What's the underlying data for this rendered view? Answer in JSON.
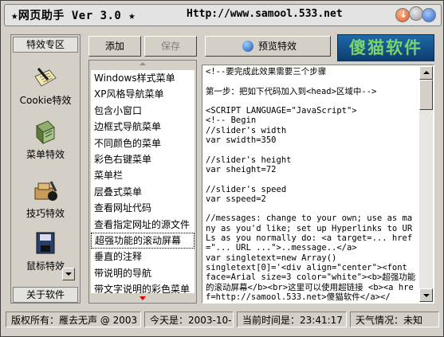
{
  "window": {
    "title": "★网页助手 Ver 3.0 ★",
    "url": "Http://www.samool.533.net"
  },
  "left_panel": {
    "header": "特效专区",
    "footer": "关于软件",
    "items": [
      {
        "label": "Cookie特效",
        "icon": "notepad-pen-icon"
      },
      {
        "label": "菜单特效",
        "icon": "menu-book-icon"
      },
      {
        "label": "技巧特效",
        "icon": "tips-tools-icon"
      },
      {
        "label": "鼠标特效",
        "icon": "mouse-disk-icon"
      }
    ]
  },
  "toolbar": {
    "add_label": "添加",
    "save_label": "保存",
    "preview_label": "预览特效"
  },
  "logo": {
    "text": "傻猫软件",
    "text_color": "#7bd36b",
    "bg_color": "#1f6aa8"
  },
  "effects_list": {
    "selected_index": 12,
    "items": [
      "Windows样式菜单",
      "XP风格导航菜单",
      "包含小窗口",
      "边框式导航菜单",
      "不同颜色的菜单",
      "彩色右键菜单",
      "菜单栏",
      "层叠式菜单",
      "查看网址代码",
      "查看指定网址的源文件",
      "超强功能的滚动屏幕",
      "垂直的注释",
      "带说明的导航",
      "带文字说明的彩色菜单"
    ]
  },
  "code": {
    "content": "<!--要完成此效果需要三个步骤\n\n第一步：把如下代码加入到<head>区域中-->\n\n<SCRIPT LANGUAGE=\"JavaScript\">\n<!-- Begin\n//slider's width\nvar swidth=350\n\n//slider's height\nvar sheight=72\n\n//slider's speed\nvar sspeed=2\n\n//messages: change to your own; use as many as you'd like; set up Hyperlinks to URLs as you normally do: <a target=... href=\"... URL ...\">..message..</a>\nvar singletext=new Array()\nsingletext[0]='<div align=\"center\"><font face=Arial size=3 color=\"white\"><b>超强功能的滚动屏幕</b><br>这里可以使用超链接 <b><a href=http://samool.533.net>傻猫软件</a></"
  },
  "status": {
    "copyright": "版权所有：雁去无声 @ 2003",
    "date": "今天是：2003-10-17",
    "time": "当前时间是：23:41:17",
    "weather": "天气情况：未知"
  },
  "colors": {
    "window_bg": "#d4d0c8",
    "accent_red": "#e00000"
  }
}
